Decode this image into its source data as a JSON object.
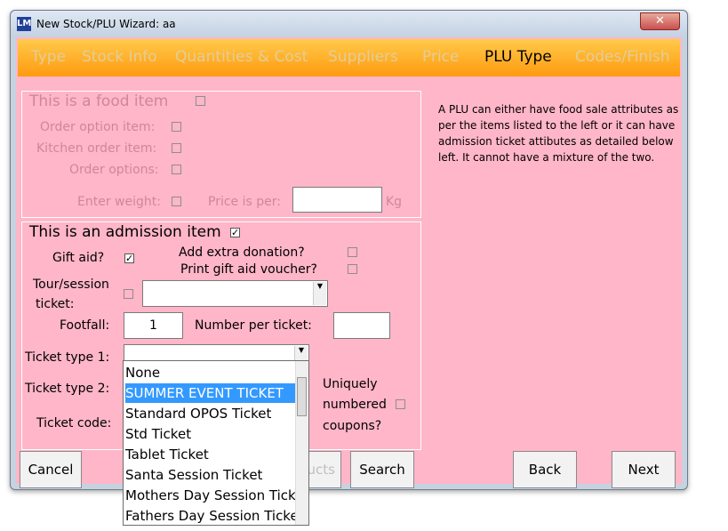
{
  "window": {
    "title": "New Stock/PLU Wizard: aa",
    "app_icon": "LM",
    "close_glyph": "✕"
  },
  "tabs": [
    {
      "label": "Type"
    },
    {
      "label": "Stock Info"
    },
    {
      "label": "Quantities & Cost"
    },
    {
      "label": "Suppliers"
    },
    {
      "label": "Price"
    },
    {
      "label": "PLU Type"
    },
    {
      "label": "Codes/Finish"
    }
  ],
  "food": {
    "title": "This is a food item",
    "order_option": "Order option item:",
    "kitchen_order": "Kitchen order item:",
    "order_options": "Order options:",
    "enter_weight": "Enter weight:",
    "price_per": "Price is per:",
    "unit": "Kg"
  },
  "admission": {
    "title": "This is an admission item",
    "gift_aid": "Gift aid?",
    "extra_donation": "Add extra donation?",
    "print_voucher": "Print gift aid voucher?",
    "tour_session_1": "Tour/session",
    "tour_session_2": "ticket:",
    "footfall": "Footfall:",
    "footfall_value": "1",
    "number_per_ticket": "Number per ticket:",
    "ticket_type_1": "Ticket type 1:",
    "ticket_type_2": "Ticket type 2:",
    "ticket_code": "Ticket code:",
    "uniquely_1": "Uniquely",
    "uniquely_2": "numbered",
    "uniquely_3": "coupons?"
  },
  "info_text": "A PLU can either have food sale attributes as per the items listed to the left or it can have admission  ticket attibutes as detailed below left.  It cannot have a mixture of the two.",
  "dropdown": {
    "items": [
      "None",
      "SUMMER EVENT TICKET",
      "Standard OPOS Ticket",
      "Std Ticket",
      "Tablet Ticket",
      "Santa Session Ticket",
      "Mothers Day Session Ticket",
      "Fathers Day Session Ticket"
    ],
    "selected_index": 1
  },
  "buttons": {
    "cancel": "Cancel",
    "products_partial": "ucts",
    "search": "Search",
    "back": "Back",
    "next": "Next"
  }
}
